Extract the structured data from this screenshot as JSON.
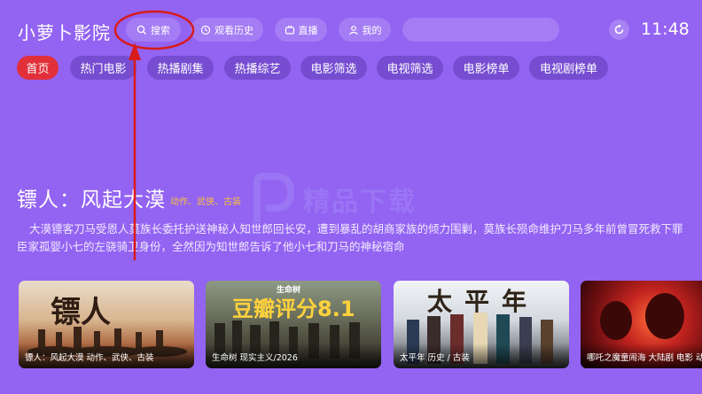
{
  "header": {
    "app_title": "小萝卜影院",
    "search_label": "搜索",
    "history_label": "观看历史",
    "live_label": "直播",
    "mine_label": "我的",
    "clock": "11:48"
  },
  "nav_tabs": [
    "首页",
    "热门电影",
    "热播剧集",
    "热播综艺",
    "电影筛选",
    "电视筛选",
    "电影榜单",
    "电视剧榜单"
  ],
  "active_tab": "首页",
  "watermark": "精品下载",
  "featured": {
    "title": "镖人：风起大漠",
    "genre": "动作、武侠、古装",
    "description": "大漠镖客刀马受恩人莫族长委托护送神秘人知世郎回长安，遭到暴乱的胡商家族的倾力围剿，莫族长殒命维护刀马多年前曾冒死救下罪臣家孤婴小七的左骁骑卫身份，全然因为知世郎告诉了他小七和刀马的神秘宿命"
  },
  "cards": [
    {
      "caption": "镖人：风起大漠    动作、武侠、古装",
      "poster_text": "镖人"
    },
    {
      "caption": "生命树    现实主义/2026",
      "poster_text": "豆瓣评分8.1",
      "top_text": "生命树"
    },
    {
      "caption": "太平年    历史 / 古装",
      "poster_text": "太平年"
    },
    {
      "caption": "哪吒之魔童闹海    大陆剧  电影  动",
      "poster_text": ""
    }
  ],
  "colors": {
    "background": "#9363f2",
    "active_tab": "#e1303a",
    "genre_text": "#f8c23a",
    "annotation": "#d81b1b"
  }
}
